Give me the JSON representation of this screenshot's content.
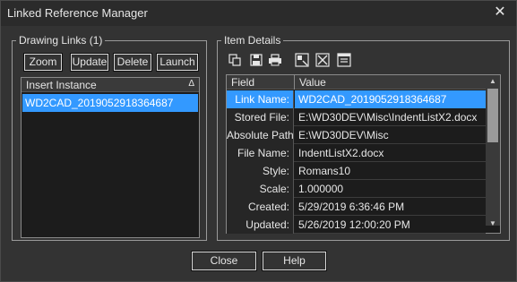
{
  "window": {
    "title": "Linked Reference Manager",
    "close_glyph": "✕"
  },
  "drawing_links": {
    "legend": "Drawing Links (1)",
    "buttons": [
      "Zoom",
      "Update",
      "Delete",
      "Launch"
    ],
    "list_header": "Insert Instance",
    "sort_indicator": "Δ",
    "items": [
      "WD2CAD_2019052918364687"
    ]
  },
  "item_details": {
    "legend": "Item Details",
    "toolbar_icons": [
      "copy-icon",
      "save-icon",
      "print-icon",
      "export-icon",
      "link-icon",
      "properties-icon"
    ],
    "headers": {
      "field": "Field",
      "value": "Value"
    },
    "rows": [
      {
        "field": "Link Name:",
        "value": "WD2CAD_2019052918364687"
      },
      {
        "field": "Stored File:",
        "value": "E:\\WD30DEV\\Misc\\IndentListX2.docx"
      },
      {
        "field": "Absolute Path:",
        "value": "E:\\WD30DEV\\Misc"
      },
      {
        "field": "File Name:",
        "value": "IndentListX2.docx"
      },
      {
        "field": "Style:",
        "value": "Romans10"
      },
      {
        "field": "Scale:",
        "value": "1.000000"
      },
      {
        "field": "Created:",
        "value": "5/29/2019 6:36:46 PM"
      },
      {
        "field": "Updated:",
        "value": "5/26/2019 12:00:20 PM"
      }
    ],
    "scroll_up_glyph": "▲",
    "scroll_down_glyph": "▼"
  },
  "footer": {
    "close_label": "Close",
    "help_label": "Help"
  },
  "colors": {
    "background": "#333333",
    "selection": "#3399ff",
    "list_background": "#1c1c1c"
  }
}
